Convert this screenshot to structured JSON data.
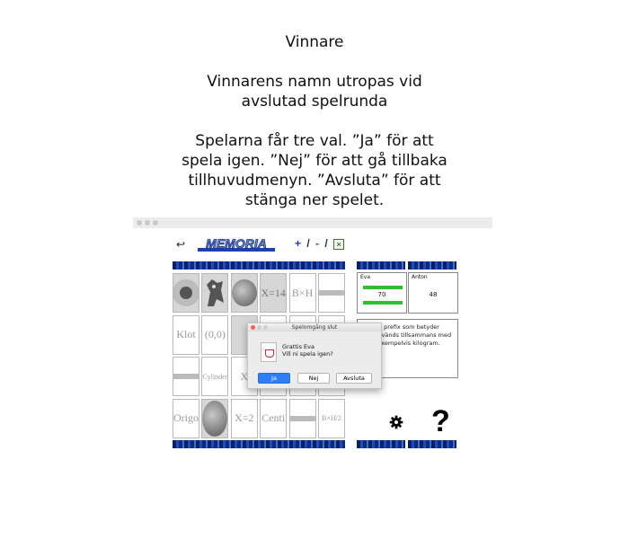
{
  "caption": {
    "title": "Vinnare",
    "p1_line1": "Vinnarens namn utropas vid",
    "p1_line2": "avslutad spelrunda",
    "p2_line1": "Spelarna får tre val. ”Ja” för att",
    "p2_line2": "spela igen. ”Nej” för att gå tillbaka",
    "p2_line3": "tillhuvudmenyn. ”Avsluta” för att",
    "p2_line4": "stänga ner spelet."
  },
  "app": {
    "logo_text": "MEMORIA",
    "ops": {
      "plus": "+",
      "slash1": "/",
      "minus": "-",
      "times": "×"
    }
  },
  "cards": [
    [
      "",
      "",
      "",
      "X=14",
      "B×H",
      ""
    ],
    [
      "Klot",
      "(0,0)",
      "",
      "",
      "",
      ""
    ],
    [
      "",
      "Cylinder",
      "X",
      "",
      "",
      ""
    ],
    [
      "Origo",
      "",
      "X=2",
      "Centi",
      "",
      "B×H/2"
    ]
  ],
  "players": [
    {
      "name": "Eva",
      "score": "70"
    },
    {
      "name": "Anton",
      "score": "48"
    }
  ],
  "info_text": {
    "line1": "ett prefix som betyder",
    "line2": "Används tillsammans med",
    "line3": ". Exempelvis kilogram."
  },
  "dialog": {
    "title": "Spelomgång slut",
    "message1": "Grattis Eva",
    "message2": "Vill ni spela igen?",
    "buttons": {
      "yes": "Ja",
      "no": "Nej",
      "quit": "Avsluta"
    }
  },
  "colors": {
    "accent_blue": "#2d7ef5",
    "score_green": "#2fc02f",
    "band_blue": "#0c2a80"
  }
}
